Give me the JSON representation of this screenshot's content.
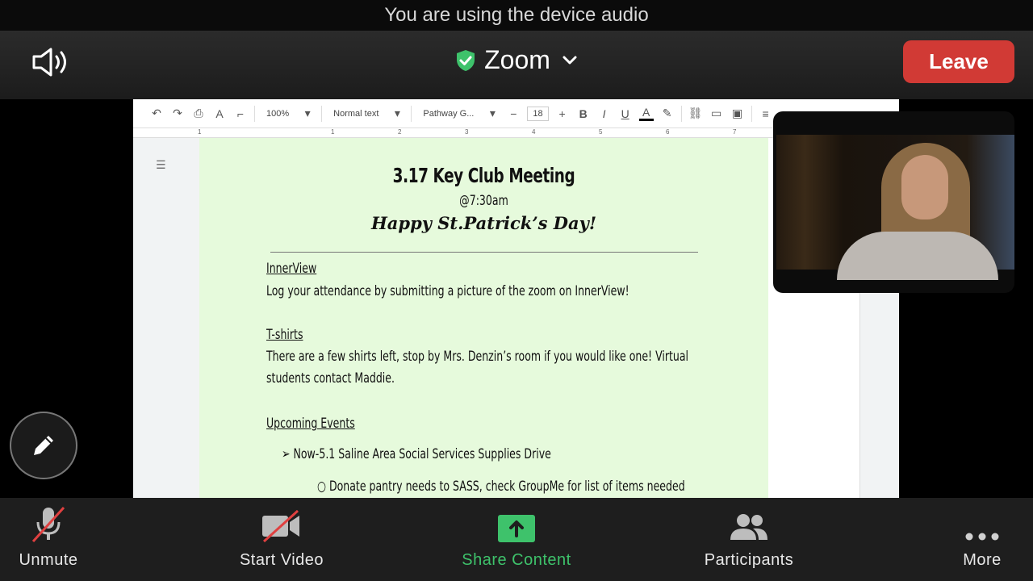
{
  "banner": {
    "text": "You are using the device audio"
  },
  "header": {
    "title": "Zoom",
    "leave_label": "Leave"
  },
  "doc_toolbar": {
    "zoom": "100%",
    "style": "Normal text",
    "font": "Pathway G...",
    "font_size": "18"
  },
  "ruler": {
    "ticks": [
      "1",
      "1",
      "2",
      "3",
      "4",
      "5",
      "6",
      "7"
    ]
  },
  "document": {
    "title": "3.17 Key Club Meeting",
    "time": "@7:30am",
    "greeting": "Happy St.Patrick’s Day!",
    "sections": [
      {
        "heading": "InnerView",
        "body": "Log your attendance by submitting a picture of the zoom on InnerView!"
      },
      {
        "heading": "T-shirts",
        "body_line1": "There are a few shirts left, stop by Mrs. Denzin’s room if you would like one! Virtual",
        "body_line2": "students contact Maddie."
      },
      {
        "heading": "Upcoming Events"
      }
    ],
    "bullet_1": "Now-5.1 Saline Area Social Services Supplies Drive",
    "sub_bullet_1": "Donate pantry needs to SASS, check GroupMe for list of items needed"
  },
  "bottom_bar": {
    "unmute": "Unmute",
    "start_video": "Start Video",
    "share": "Share Content",
    "participants": "Participants",
    "more": "More"
  },
  "colors": {
    "leave_red": "#d13a35",
    "share_green": "#3ec26b",
    "page_green": "#e6fadc",
    "shield_green": "#3ec26b"
  }
}
